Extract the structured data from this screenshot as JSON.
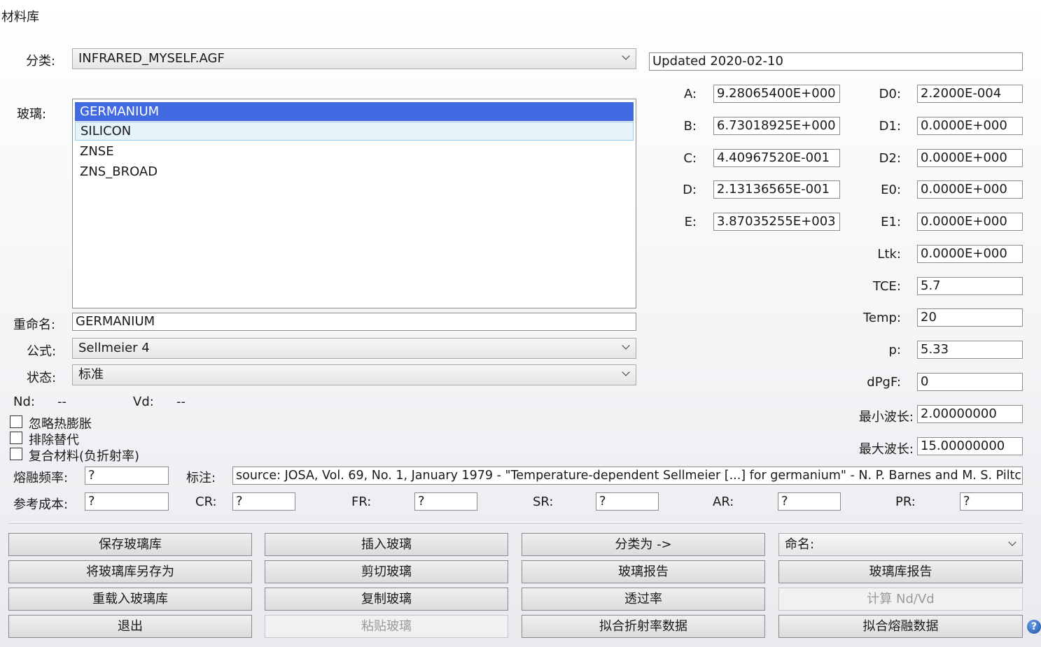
{
  "window": {
    "title": "材料库"
  },
  "catalog": {
    "label": "分类:",
    "value": "INFRARED_MYSELF.AGF",
    "updated": "Updated 2020-02-10"
  },
  "glass": {
    "label": "玻璃:",
    "items": [
      "GERMANIUM",
      "SILICON",
      "ZNSE",
      "ZNS_BROAD"
    ]
  },
  "rename": {
    "label": "重命名:",
    "value": "GERMANIUM"
  },
  "formula": {
    "label": "公式:",
    "value": "Sellmeier 4"
  },
  "status": {
    "label": "状态:",
    "value": "标准"
  },
  "nd": {
    "label": "Nd:",
    "value": "--"
  },
  "vd": {
    "label": "Vd:",
    "value": "--"
  },
  "checkboxes": {
    "ignore_thermal": {
      "label": "忽略热膨胀",
      "checked": false
    },
    "exclude_sub": {
      "label": "排除替代",
      "checked": false
    },
    "composite": {
      "label": "复合材料(负折射率)",
      "checked": false
    }
  },
  "coeffs": {
    "A": {
      "label": "A:",
      "value": "9.28065400E+000"
    },
    "B": {
      "label": "B:",
      "value": "6.73018925E+000"
    },
    "C": {
      "label": "C:",
      "value": "4.40967520E-001"
    },
    "D": {
      "label": "D:",
      "value": "2.13136565E-001"
    },
    "E": {
      "label": "E:",
      "value": "3.87035255E+003"
    }
  },
  "thermal": {
    "D0": {
      "label": "D0:",
      "value": "2.2000E-004"
    },
    "D1": {
      "label": "D1:",
      "value": "0.0000E+000"
    },
    "D2": {
      "label": "D2:",
      "value": "0.0000E+000"
    },
    "E0": {
      "label": "E0:",
      "value": "0.0000E+000"
    },
    "E1": {
      "label": "E1:",
      "value": "0.0000E+000"
    },
    "Ltk": {
      "label": "Ltk:",
      "value": "0.0000E+000"
    },
    "TCE": {
      "label": "TCE:",
      "value": "5.7"
    },
    "Temp": {
      "label": "Temp:",
      "value": "20"
    },
    "p": {
      "label": "p:",
      "value": "5.33"
    },
    "dPgF": {
      "label": "dPgF:",
      "value": "0"
    },
    "min_wave": {
      "label": "最小波长:",
      "value": "2.00000000"
    },
    "max_wave": {
      "label": "最大波长:",
      "value": "15.00000000"
    }
  },
  "melt_freq": {
    "label": "熔融频率:",
    "value": "?"
  },
  "note": {
    "label": "标注:",
    "value": "source:  JOSA, Vol. 69, No. 1, January 1979 - \"Temperature-dependent Sellmeier [...] for germanium\" - N. P. Barnes and M. S. Piltch"
  },
  "cost": {
    "label": "参考成本:",
    "value": "?"
  },
  "cr": {
    "label": "CR:",
    "value": "?"
  },
  "fr": {
    "label": "FR:",
    "value": "?"
  },
  "sr": {
    "label": "SR:",
    "value": "?"
  },
  "ar": {
    "label": "AR:",
    "value": "?"
  },
  "pr": {
    "label": "PR:",
    "value": "?"
  },
  "buttons": {
    "save": "保存玻璃库",
    "save_as": "将玻璃库另存为",
    "reload": "重载入玻璃库",
    "exit": "退出",
    "insert": "插入玻璃",
    "cut": "剪切玻璃",
    "copy": "复制玻璃",
    "paste": "粘贴玻璃",
    "classify": "分类为 ->",
    "report": "玻璃报告",
    "transmission": "透过率",
    "fit_index": "拟合折射率数据",
    "name_combo": "命名:",
    "catalog_report": "玻璃库报告",
    "calc_nd_vd": "计算 Nd/Vd",
    "fit_melt": "拟合熔融数据"
  },
  "help": "?"
}
